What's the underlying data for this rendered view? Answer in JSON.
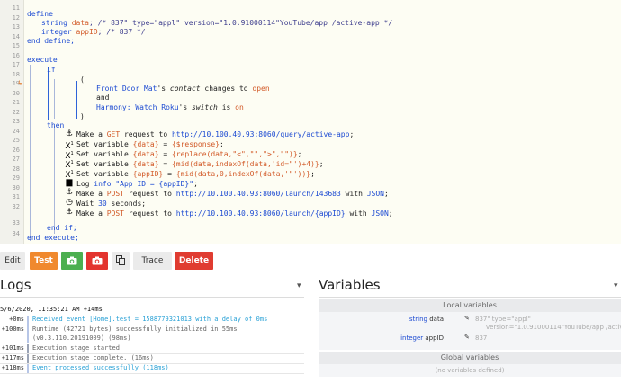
{
  "editor": {
    "line_numbers": [
      "11",
      "12",
      "13",
      "14",
      "15",
      "16",
      "17",
      "18",
      "19",
      "20",
      "21",
      "22",
      "23",
      "24",
      "25",
      "26",
      "27",
      "28",
      "29",
      "30",
      "31",
      "32",
      "33",
      "34"
    ],
    "lines": {
      "l11": "define",
      "l12_type": "string",
      "l12_var": "data",
      "l12_comment": "; /* 837\" type=\"appl\" version=\"1.0.91000114\"YouTube/app /active-app */",
      "l13_type": "integer",
      "l13_var": "appID",
      "l13_comment": "; /* 837 */",
      "l14": "end define;",
      "l16": "execute",
      "l17": "if",
      "l18": "(",
      "l19_dev": "Front Door Mat",
      "l19_mid": "'s ",
      "l19_attr": "contact",
      "l19_op": " changes to ",
      "l19_val": "open",
      "l20": "and",
      "l21_dev": "Harmony: Watch Roku",
      "l21_mid": "'s ",
      "l21_attr": "switch",
      "l21_op": " is ",
      "l21_val": "on",
      "l22": ")",
      "l23": "then",
      "l24_a": "Make a ",
      "l24_method": "GET",
      "l24_b": " request to ",
      "l24_url": "http://10.100.40.93:8060/query/active-app",
      "l24_c": ";",
      "l25_a": "Set variable ",
      "l25_var": "{data}",
      "l25_b": " = ",
      "l25_val": "{$response}",
      "l25_c": ";",
      "l26_a": "Set variable ",
      "l26_var": "{data}",
      "l26_b": " = ",
      "l26_val": "{replace(data,\"<\",\"\",\">\",\"\")}",
      "l26_c": ";",
      "l27_a": "Set variable ",
      "l27_var": "{data}",
      "l27_b": " = ",
      "l27_val": "{mid(data,indexOf(data,'id=\"')+4)}",
      "l27_c": ";",
      "l28_a": "Set variable ",
      "l28_var": "{appID}",
      "l28_b": " = ",
      "l28_val": "{mid(data,0,indexOf(data,'\"'))}",
      "l28_c": ";",
      "l29_a": "Log ",
      "l29_lvl": "info",
      "l29_b": " ",
      "l29_msg": "\"App ID = {appID}\"",
      "l29_c": ";",
      "l30_a": "Make a ",
      "l30_method": "POST",
      "l30_b": " request to ",
      "l30_url": "http://10.100.40.93:8060/launch/143683",
      "l30_c": " with ",
      "l30_fmt": "JSON",
      "l30_d": ";",
      "l31_a": "Wait ",
      "l31_num": "30",
      "l31_b": " seconds;",
      "l32_a": "Make a ",
      "l32_method": "POST",
      "l32_b": " request to ",
      "l32_url": "http://10.100.40.93:8060/launch/{appID}",
      "l32_c": " with ",
      "l32_fmt": "JSON",
      "l32_d": ";",
      "l33": "end if;",
      "l34": "end execute;"
    }
  },
  "toolbar": {
    "edit": "Edit",
    "test": "Test",
    "trace": "Trace",
    "delete": "Delete"
  },
  "logs": {
    "title": "Logs",
    "date": "5/6/2020, 11:35:21 AM +14ms",
    "entries": [
      {
        "time": "+0ms",
        "msg": "Received event [Home].test = 1588779321013 with a delay of 0ms"
      },
      {
        "time": "+100ms",
        "msg": "Runtime (42721 bytes) successfully initialized in 55ms",
        "msg2": "(v0.3.110.20191009) (98ms)"
      },
      {
        "time": "+101ms",
        "msg": "Execution stage started"
      },
      {
        "time": "+117ms",
        "msg": "Execution stage complete. (16ms)"
      },
      {
        "time": "+118ms",
        "msg": "Event processed successfully (118ms)"
      }
    ]
  },
  "variables": {
    "title": "Variables",
    "local_header": "Local variables",
    "global_header": "Global variables",
    "global_empty": "(no variables defined)",
    "local": [
      {
        "type": "string",
        "name": "data",
        "value1": "837\" type=\"appl\"",
        "value2": "version=\"1.0.91000114\"YouTube/app /active-app"
      },
      {
        "type": "integer",
        "name": "appID",
        "value1": "837"
      }
    ]
  }
}
